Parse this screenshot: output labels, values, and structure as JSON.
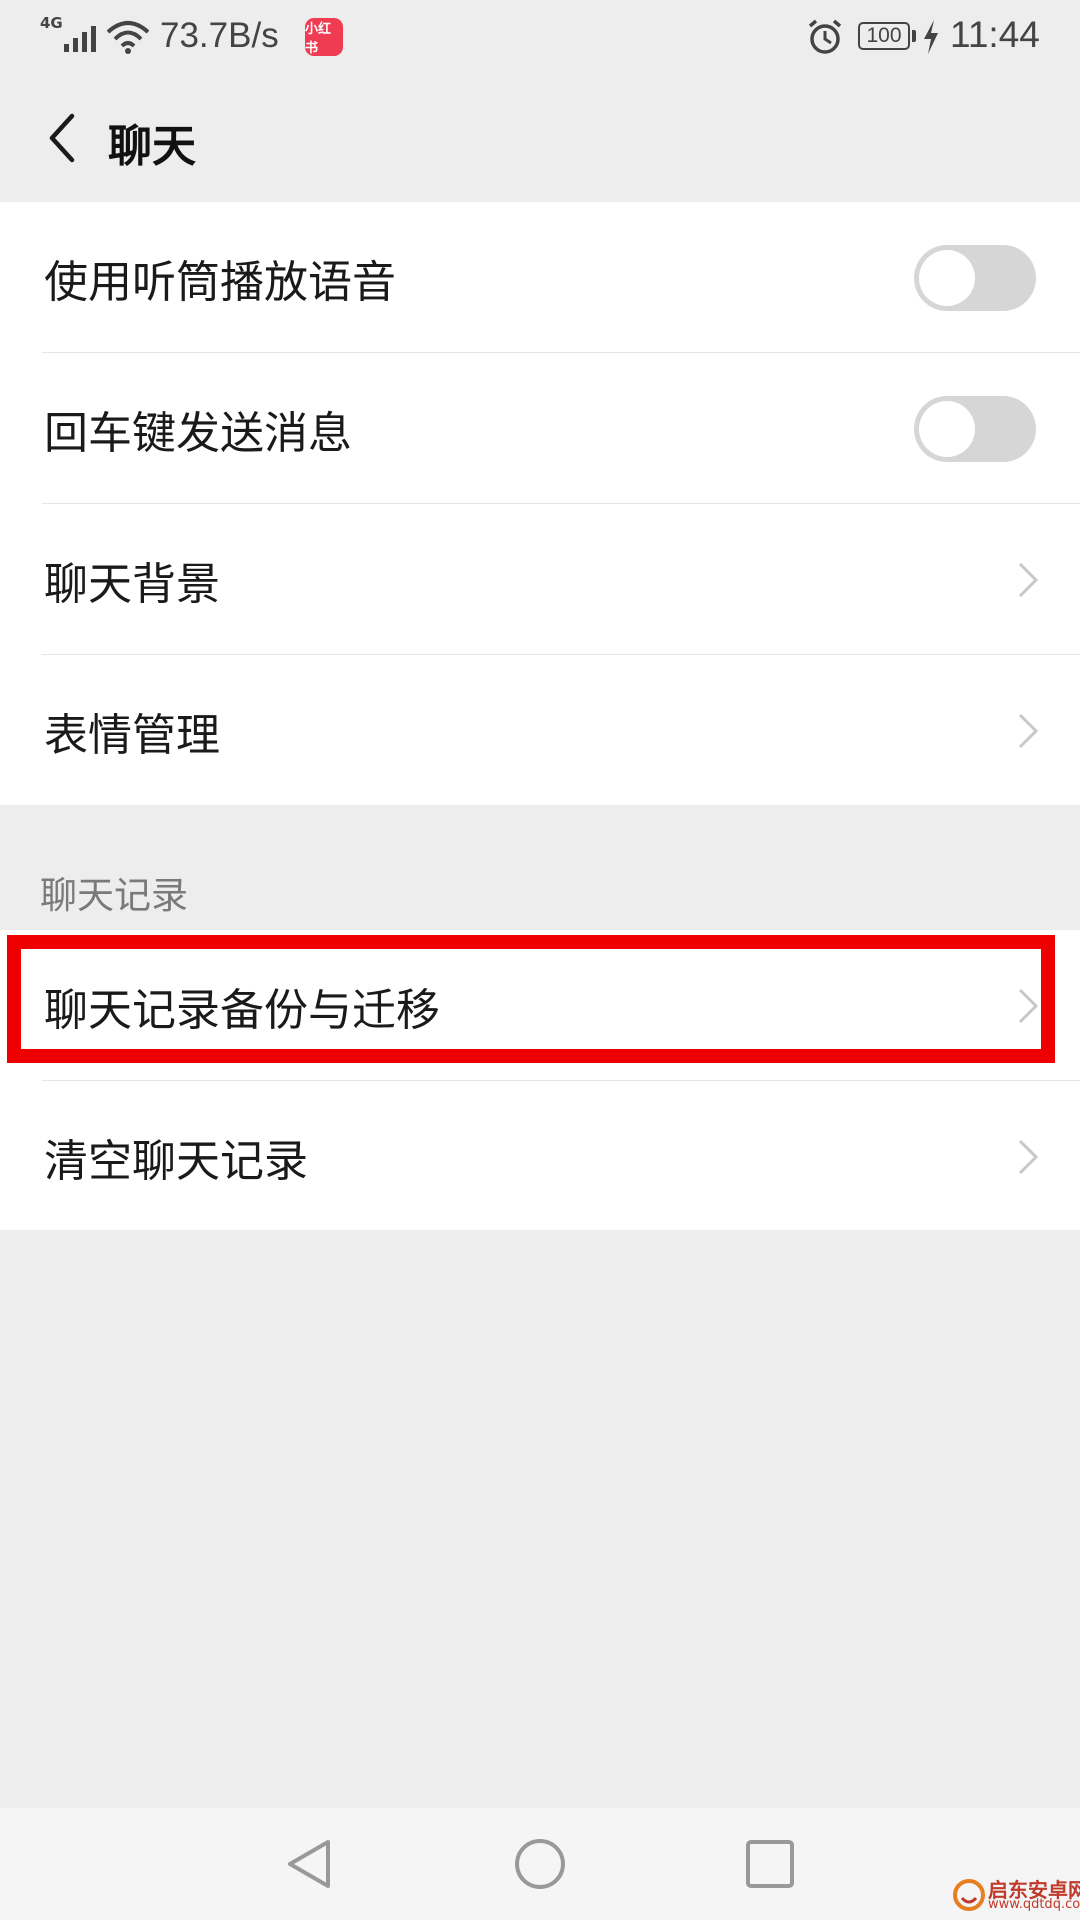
{
  "status_bar": {
    "network_type": "4G",
    "net_speed": "73.7B/s",
    "app_badge": "小红书",
    "battery": "100",
    "time": "11:44",
    "icons": [
      "signal-icon",
      "wifi-icon",
      "alarm-icon",
      "battery-icon",
      "charging-bolt-icon"
    ]
  },
  "header": {
    "title": "聊天",
    "back_icon": "chevron-left-icon"
  },
  "settings": {
    "toggle_items": [
      {
        "label": "使用听筒播放语音",
        "enabled": false
      },
      {
        "label": "回车键发送消息",
        "enabled": false
      }
    ],
    "link_items": [
      {
        "label": "聊天背景"
      },
      {
        "label": "表情管理"
      }
    ]
  },
  "history_section": {
    "header": "聊天记录",
    "items": [
      {
        "label": "聊天记录备份与迁移",
        "highlighted": true
      },
      {
        "label": "清空聊天记录"
      }
    ]
  },
  "system_nav": {
    "icons": [
      "back-triangle-icon",
      "home-circle-icon",
      "recent-square-icon"
    ]
  },
  "watermark": {
    "name": "启东安卓网",
    "url": "www.qdtdq.com"
  },
  "colors": {
    "background": "#ededed",
    "card": "#ffffff",
    "highlight": "#ee0000",
    "toggle_off": "#d6d6d6"
  }
}
